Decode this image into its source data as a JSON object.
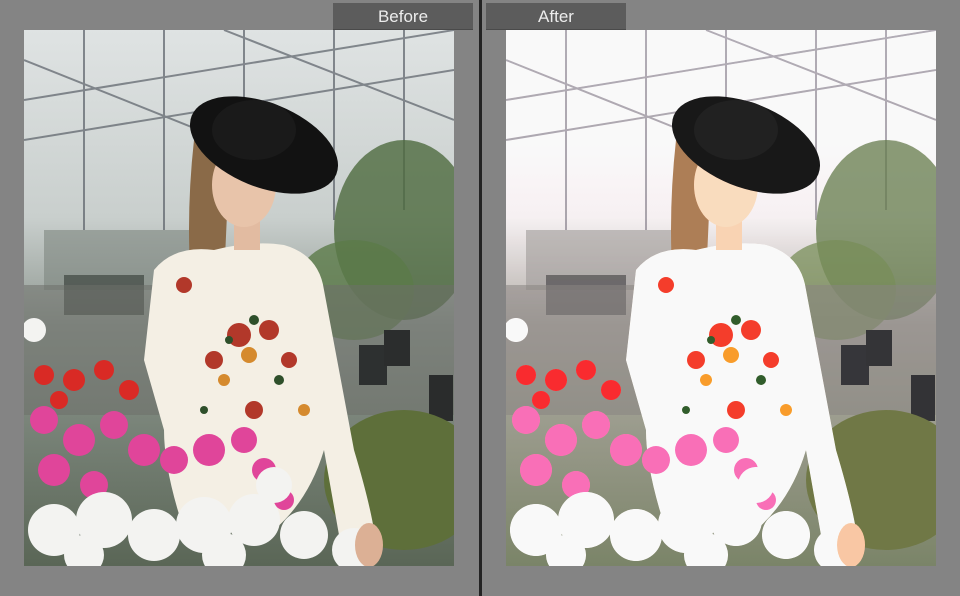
{
  "before": {
    "label": "Before"
  },
  "after": {
    "label": "After"
  },
  "colors": {
    "panel": "#848484",
    "tab_bg": "#5c5c5c",
    "tab_text": "#ececec",
    "divider": "#232323"
  }
}
